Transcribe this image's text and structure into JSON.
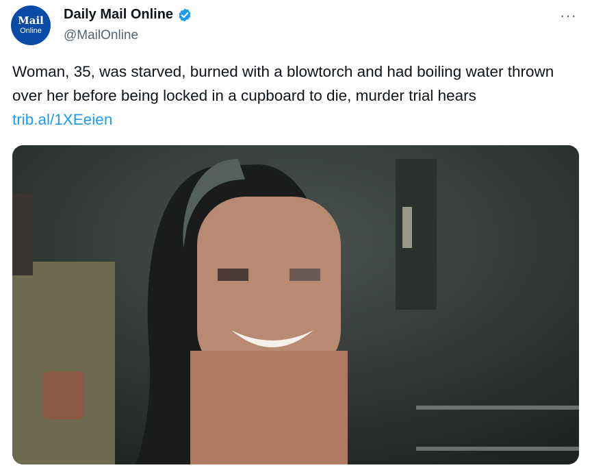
{
  "author": {
    "avatar_line1": "Mail",
    "avatar_line2": "Online",
    "display_name": "Daily Mail Online",
    "handle": "@MailOnline"
  },
  "more_label": "···",
  "tweet": {
    "text": "Woman, 35, was starved, burned with a blowtorch and had boiling water thrown over her before being locked in a cupboard to die, murder trial hears",
    "link": "trib.al/1XEeien"
  },
  "icons": {
    "verified": "verified-badge-icon",
    "more": "more-options-icon"
  },
  "colors": {
    "link": "#1d9bf0",
    "avatar_bg": "#0a4ba8",
    "text": "#0f1419",
    "secondary": "#536471"
  }
}
